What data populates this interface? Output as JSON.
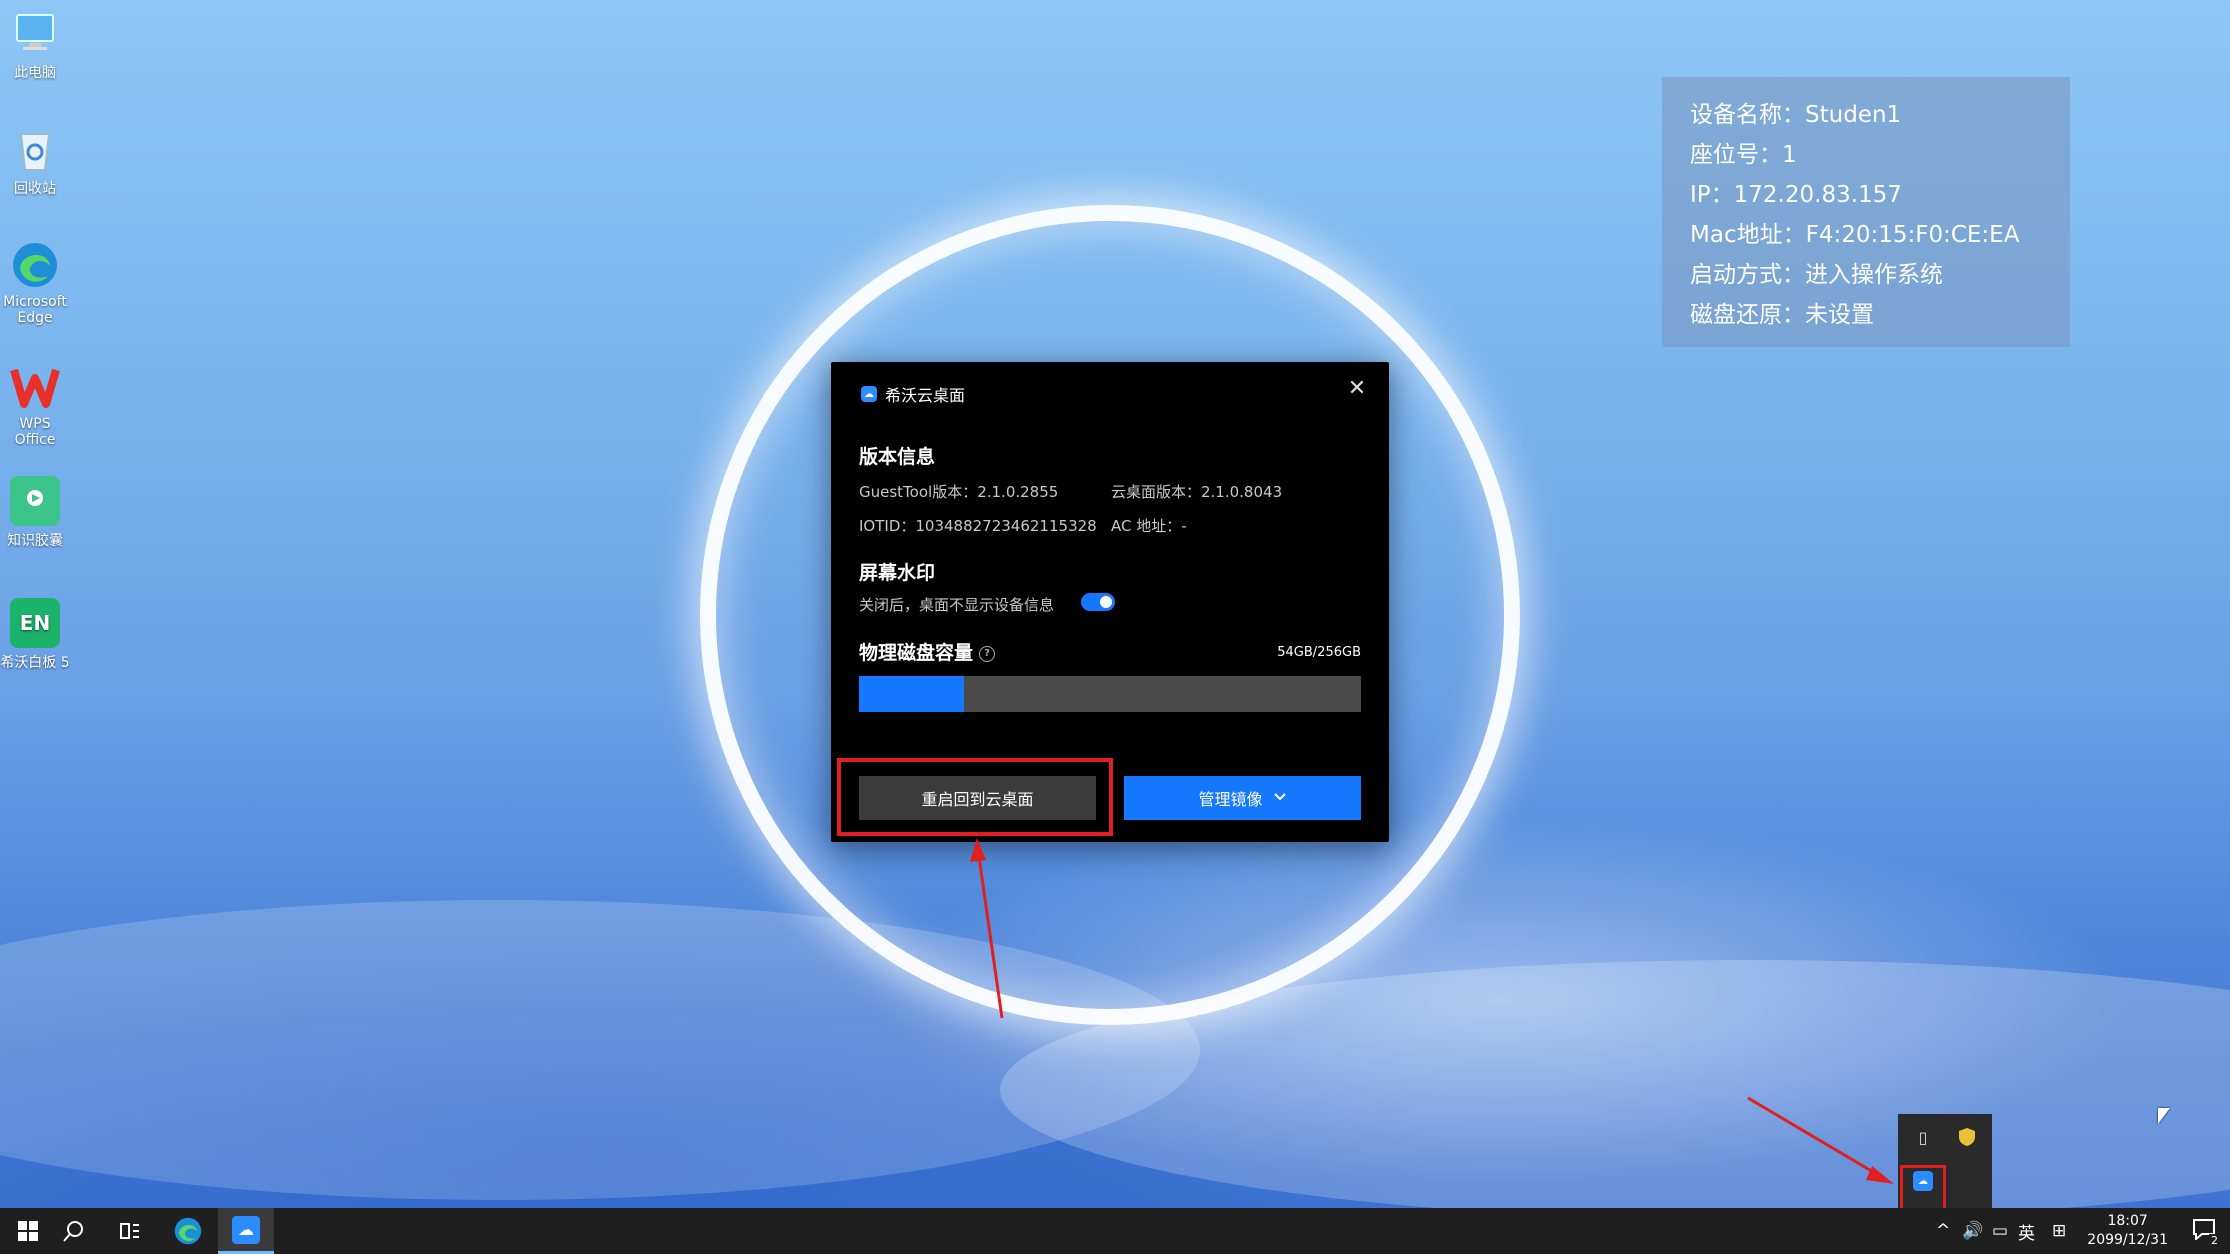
{
  "desktop_icons": [
    {
      "label": "此电脑",
      "icon": "computer-icon"
    },
    {
      "label": "回收站",
      "icon": "recycle-bin-icon"
    },
    {
      "label": "Microsoft Edge",
      "icon": "edge-icon"
    },
    {
      "label": "WPS Office",
      "icon": "wps-icon"
    },
    {
      "label": "知识胶囊",
      "icon": "capsule-icon"
    },
    {
      "label": "希沃白板 5",
      "icon": "easinote-icon"
    }
  ],
  "info_panel": {
    "device_name": "设备名称：Studen1",
    "seat": "座位号：1",
    "ip": "IP：172.20.83.157",
    "mac": "Mac地址：F4:20:15:F0:CE:EA",
    "boot_mode": "启动方式：进入操作系统",
    "disk_restore": "磁盘还原：未设置"
  },
  "dialog": {
    "title": "希沃云桌面",
    "version_heading": "版本信息",
    "guesttool_version": "GuestTool版本：2.1.0.2855",
    "cloud_desktop_version": "云桌面版本：2.1.0.8043",
    "iotid": "IOTID：1034882723462115328",
    "ac_address": "AC 地址：-",
    "watermark_heading": "屏幕水印",
    "watermark_desc": "关闭后，桌面不显示设备信息",
    "watermark_enabled": true,
    "disk_heading": "物理磁盘容量",
    "disk_usage": "54GB/256GB",
    "disk_used_fraction": 0.21,
    "restart_button": "重启回到云桌面",
    "manage_button": "管理镜像"
  },
  "taskbar": {
    "ime": "英",
    "time": "18:07",
    "date": "2099/12/31",
    "notification_count": "2"
  },
  "colors": {
    "accent": "#1677ff",
    "highlight": "#e02020"
  }
}
